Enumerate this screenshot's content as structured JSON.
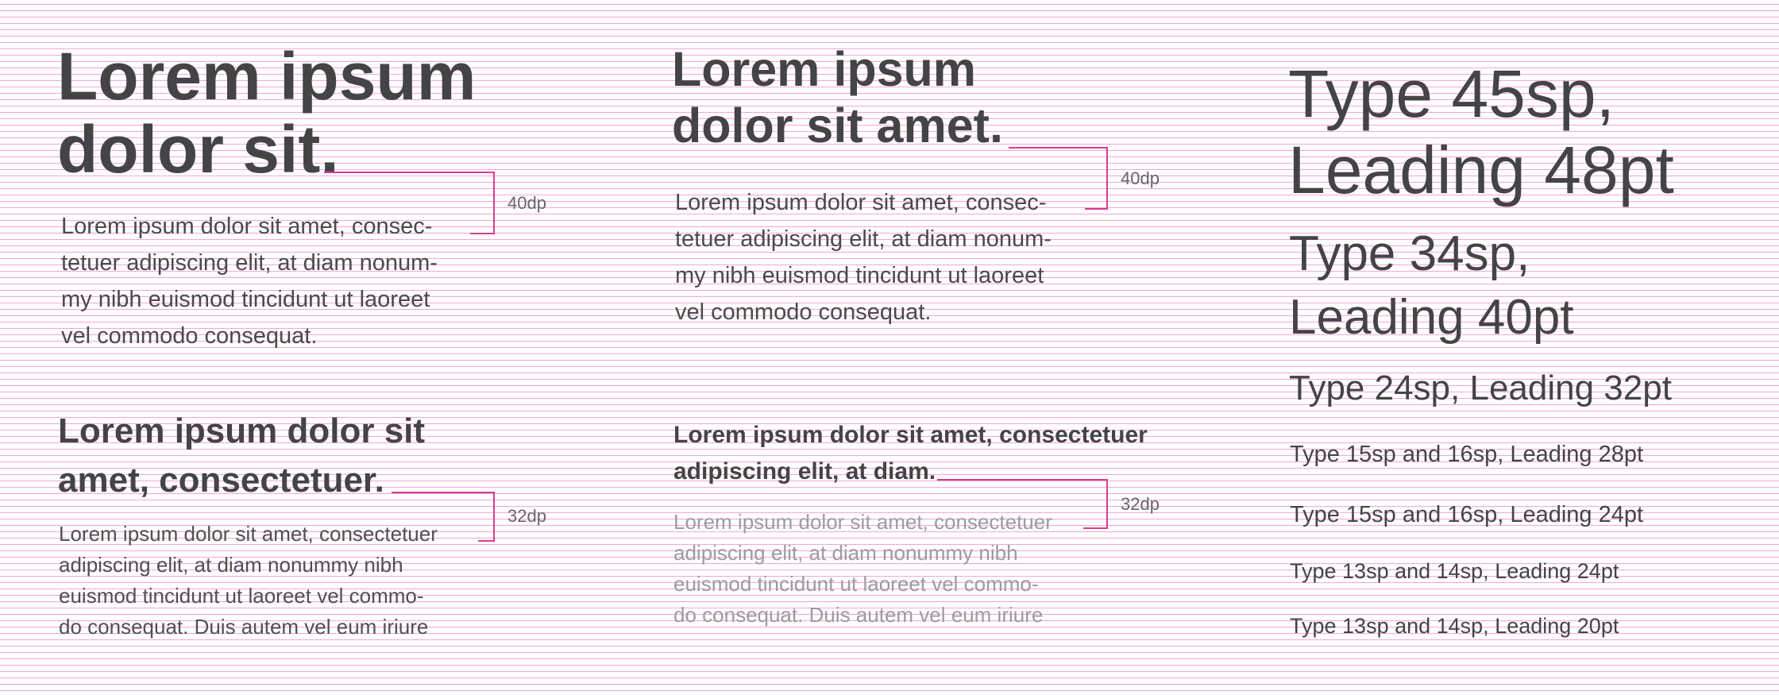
{
  "col1": {
    "heading": [
      "Lorem ipsum",
      "dolor sit."
    ],
    "body": [
      "Lorem ipsum dolor sit amet, consec-",
      "tetuer adipiscing elit, at diam nonum-",
      "my nibh euismod tincidunt ut laoreet",
      "vel commodo consequat."
    ],
    "measure": "40dp",
    "heading2": [
      "Lorem ipsum dolor sit",
      "amet, consectetuer."
    ],
    "body2": [
      "Lorem ipsum dolor sit amet, consectetuer",
      "adipiscing elit, at diam nonummy nibh",
      "euismod tincidunt ut laoreet vel commo-",
      "do consequat. Duis autem vel eum iriure"
    ],
    "measure2": "32dp"
  },
  "col2": {
    "heading": [
      "Lorem ipsum",
      "dolor sit amet."
    ],
    "body": [
      "Lorem ipsum dolor sit amet, consec-",
      "tetuer adipiscing elit, at diam nonum-",
      "my nibh euismod tincidunt ut laoreet",
      "vel commodo consequat."
    ],
    "measure": "40dp",
    "heading2": [
      "Lorem ipsum dolor sit amet, consectetuer",
      "adipiscing elit, at diam."
    ],
    "body2": [
      "Lorem ipsum dolor sit amet, consectetuer",
      "adipiscing elit, at diam nonummy nibh",
      "euismod tincidunt ut laoreet vel commo-",
      "do consequat. Duis autem vel eum iriure"
    ],
    "measure2": "32dp"
  },
  "col3": {
    "styles": [
      [
        "Type 45sp,",
        "Leading 48pt"
      ],
      [
        "Type 34sp,",
        "Leading 40pt"
      ],
      [
        "Type 24sp, Leading 32pt"
      ],
      [
        "Type 15sp and 16sp, Leading 28pt"
      ],
      [
        "Type 15sp and 16sp, Leading 24pt"
      ],
      [
        "Type 13sp and 14sp, Leading 24pt"
      ],
      [
        "Type 13sp and 14sp, Leading 20pt"
      ]
    ]
  },
  "colors": {
    "text": "#444447",
    "muted_text": "#9c9ca0",
    "baseline_grid": "#f2a8d6",
    "measure_mark": "#d63c96"
  }
}
